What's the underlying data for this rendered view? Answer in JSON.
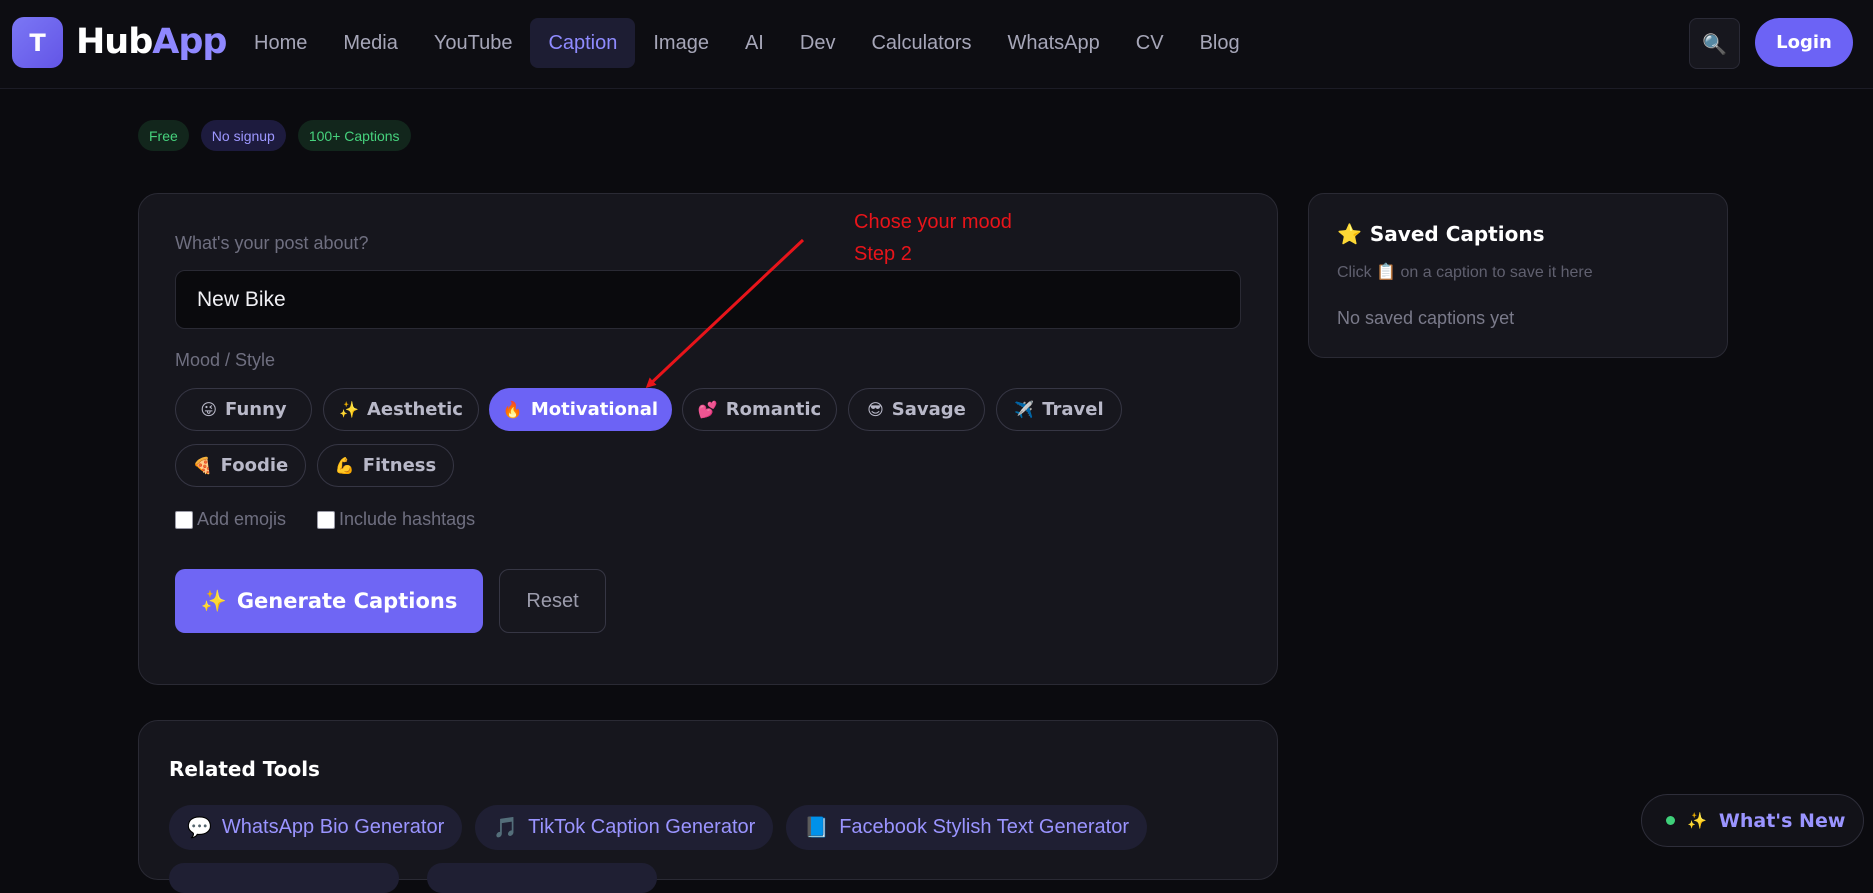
{
  "header": {
    "logo_letter": "T",
    "logo_hub": "Hub",
    "logo_app": "App",
    "nav": [
      "Home",
      "Media",
      "YouTube",
      "Caption",
      "Image",
      "AI",
      "Dev",
      "Calculators",
      "WhatsApp",
      "CV",
      "Blog"
    ],
    "active_nav": "Caption",
    "search_icon": "🔍",
    "login_label": "Login"
  },
  "badges": [
    "Free",
    "No signup",
    "100+ Captions"
  ],
  "form": {
    "post_label": "What's your post about?",
    "post_value": "New Bike",
    "mood_label": "Mood / Style",
    "moods": [
      {
        "emoji": "😜",
        "label": "Funny"
      },
      {
        "emoji": "✨",
        "label": "Aesthetic"
      },
      {
        "emoji": "🔥",
        "label": "Motivational"
      },
      {
        "emoji": "💕",
        "label": "Romantic"
      },
      {
        "emoji": "😎",
        "label": "Savage"
      },
      {
        "emoji": "✈️",
        "label": "Travel"
      },
      {
        "emoji": "🍕",
        "label": "Foodie"
      },
      {
        "emoji": "💪",
        "label": "Fitness"
      }
    ],
    "selected_mood": "Motivational",
    "add_emojis_label": "Add emojis",
    "include_hashtags_label": "Include hashtags",
    "generate_label": "Generate Captions",
    "generate_icon": "✨",
    "reset_label": "Reset"
  },
  "annotation": {
    "line1": "Chose your mood",
    "line2": "Step 2",
    "color": "#e8141a"
  },
  "saved": {
    "icon": "⭐",
    "title": "Saved Captions",
    "hint_prefix": "Click",
    "hint_icon": "📋",
    "hint_suffix": "on a caption to save it here",
    "empty": "No saved captions yet"
  },
  "related": {
    "title": "Related Tools",
    "tools": [
      {
        "icon": "💬",
        "label": "WhatsApp Bio Generator"
      },
      {
        "icon": "🎵",
        "label": "TikTok Caption Generator"
      },
      {
        "icon": "📘",
        "label": "Facebook Stylish Text Generator"
      }
    ]
  },
  "whats_new": {
    "icon": "✨",
    "label": "What's New"
  },
  "colors": {
    "accent": "#6c63f5",
    "background": "#0b0b0f",
    "card": "#16161d"
  }
}
